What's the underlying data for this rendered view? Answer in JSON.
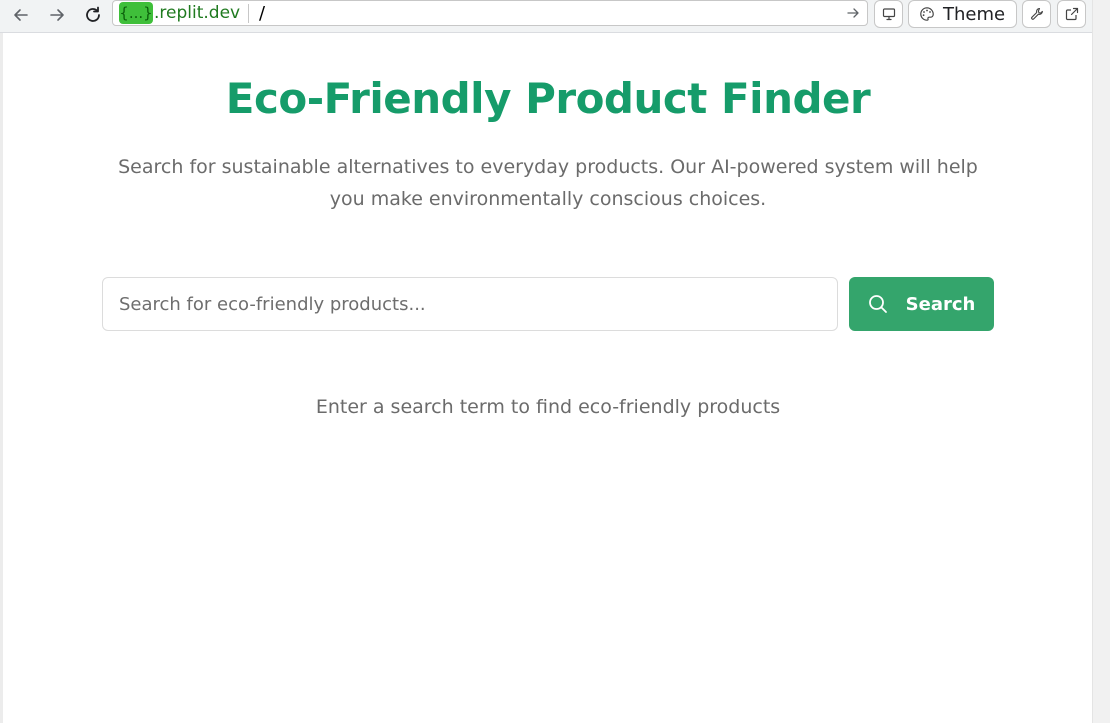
{
  "browser": {
    "url_badge": "{...}",
    "url_domain": ".replit.dev",
    "url_path": "/",
    "theme_label": "Theme"
  },
  "page": {
    "title": "Eco-Friendly Product Finder",
    "subtitle": "Search for sustainable alternatives to everyday products. Our AI-powered system will help you make environmentally conscious choices.",
    "search": {
      "placeholder": "Search for eco-friendly products...",
      "value": "",
      "button_label": "Search"
    },
    "empty_state": "Enter a search term to find eco-friendly products"
  },
  "colors": {
    "brand_green": "#169c6a",
    "button_green": "#34a56c",
    "muted_text": "#6b6b6b",
    "url_badge": "#3fbf3a"
  },
  "icons": {
    "back": "arrow-left-icon",
    "forward": "arrow-right-icon",
    "reload": "reload-icon",
    "go": "arrow-right-small-icon",
    "devtools": "monitor-icon",
    "theme": "palette-icon",
    "wrench": "wrench-icon",
    "open_external": "external-link-icon",
    "search": "search-icon"
  }
}
